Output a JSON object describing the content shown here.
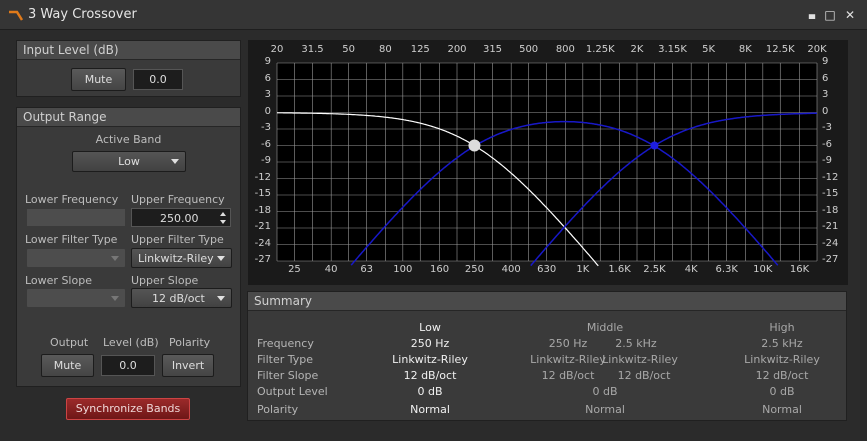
{
  "window": {
    "title": "3 Way Crossover",
    "minimize_glyph": "▄",
    "maximize_glyph": "□",
    "close_glyph": "✕"
  },
  "input_level": {
    "header": "Input Level (dB)",
    "mute_label": "Mute",
    "value": "0.0"
  },
  "output_range": {
    "header": "Output Range",
    "active_band_label": "Active Band",
    "active_band_value": "Low",
    "lower_frequency_label": "Lower Frequency",
    "upper_frequency_label": "Upper Frequency",
    "lower_frequency_value": "",
    "upper_frequency_value": "250.00",
    "lower_filter_type_label": "Lower Filter Type",
    "upper_filter_type_label": "Upper Filter Type",
    "lower_filter_type_value": "",
    "upper_filter_type_value": "Linkwitz-Riley",
    "lower_slope_label": "Lower Slope",
    "upper_slope_label": "Upper Slope",
    "lower_slope_value": "",
    "upper_slope_value": "12 dB/oct",
    "output_label": "Output",
    "level_label": "Level (dB)",
    "polarity_label": "Polarity",
    "mute_label": "Mute",
    "level_value": "0.0",
    "invert_label": "Invert"
  },
  "sync_label": "Synchronize Bands",
  "graph": {
    "top_ticks": [
      "20",
      "31.5",
      "50",
      "80",
      "125",
      "200",
      "315",
      "500",
      "800",
      "1.25K",
      "2K",
      "3.15K",
      "5K",
      "8K",
      "12.5K",
      "20K"
    ],
    "bottom_ticks": [
      "25",
      "40",
      "63",
      "100",
      "160",
      "250",
      "400",
      "630",
      "1K",
      "1.6K",
      "2.5K",
      "4K",
      "6.3K",
      "10K",
      "16K"
    ],
    "y_ticks": [
      "9",
      "6",
      "3",
      "0",
      "-3",
      "-6",
      "-9",
      "-12",
      "-15",
      "-18",
      "-21",
      "-24",
      "-27"
    ],
    "colors": {
      "low_curve": "#ffffff",
      "mid_curve": "#1818c8",
      "high_curve": "#1818c8",
      "grid": "#9a9a9a",
      "background": "#000000"
    },
    "low_cutoff_hz": 250,
    "high_cutoff_hz": 2500,
    "slope_db_oct": 12
  },
  "summary": {
    "header": "Summary",
    "col_low": "Low",
    "col_middle": "Middle",
    "col_high": "High",
    "row_labels": [
      "Frequency",
      "Filter Type",
      "Filter Slope",
      "Output Level",
      "Polarity"
    ],
    "low": {
      "frequency": "250 Hz",
      "filter_type": "Linkwitz-Riley",
      "filter_slope": "12 dB/oct",
      "output_level": "0 dB",
      "polarity": "Normal"
    },
    "middle": {
      "frequency_a": "250 Hz",
      "frequency_b": "2.5 kHz",
      "filter_type_a": "Linkwitz-Riley",
      "filter_type_b": "Linkwitz-Riley",
      "filter_slope_a": "12 dB/oct",
      "filter_slope_b": "12 dB/oct",
      "output_level": "0 dB",
      "polarity": "Normal"
    },
    "high": {
      "frequency": "2.5 kHz",
      "filter_type": "Linkwitz-Riley",
      "filter_slope": "12 dB/oct",
      "output_level": "0 dB",
      "polarity": "Normal"
    }
  }
}
